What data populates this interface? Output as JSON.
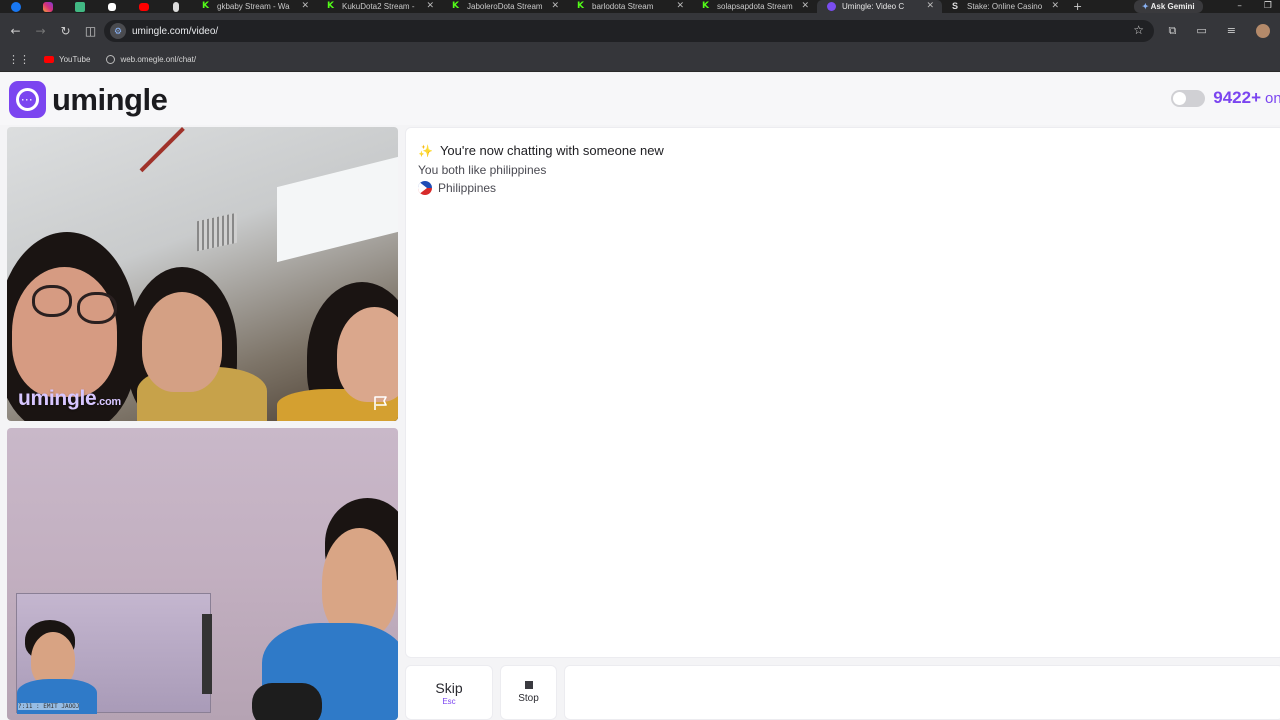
{
  "browser": {
    "tabs": [
      {
        "title": "gkbaby Stream - Wa",
        "icon": "kick-icon"
      },
      {
        "title": "KukuDota2 Stream -",
        "icon": "kick-icon"
      },
      {
        "title": "JaboleroDota Stream",
        "icon": "kick-icon"
      },
      {
        "title": "barlodota Stream",
        "icon": "kick-icon"
      },
      {
        "title": "solapsapdota Stream",
        "icon": "kick-icon"
      },
      {
        "title": "Umingle: Video C",
        "icon": "umingle-icon",
        "active": true
      },
      {
        "title": "Stake: Online Casino",
        "icon": "stake-icon"
      }
    ],
    "gemini_label": "Ask Gemini",
    "url": "umingle.com/video/",
    "bookmarks": [
      {
        "label": "YouTube",
        "icon": "youtube-icon"
      },
      {
        "label": "web.omegle.onl/chat/",
        "icon": "globe-icon"
      }
    ]
  },
  "site": {
    "brand": "umingle",
    "online_count": "9422+",
    "online_label": "online",
    "brand_color": "#7b45f0"
  },
  "video": {
    "watermark": "umingle",
    "watermark_domain": ".com",
    "pip_caption": "?:11 : EMIT JAOOJ"
  },
  "chat": {
    "status": "You're now chatting with someone new",
    "common_interest": "You both like philippines",
    "country": "Philippines"
  },
  "controls": {
    "skip_label": "Skip",
    "skip_shortcut": "Esc",
    "stop_label": "Stop"
  }
}
